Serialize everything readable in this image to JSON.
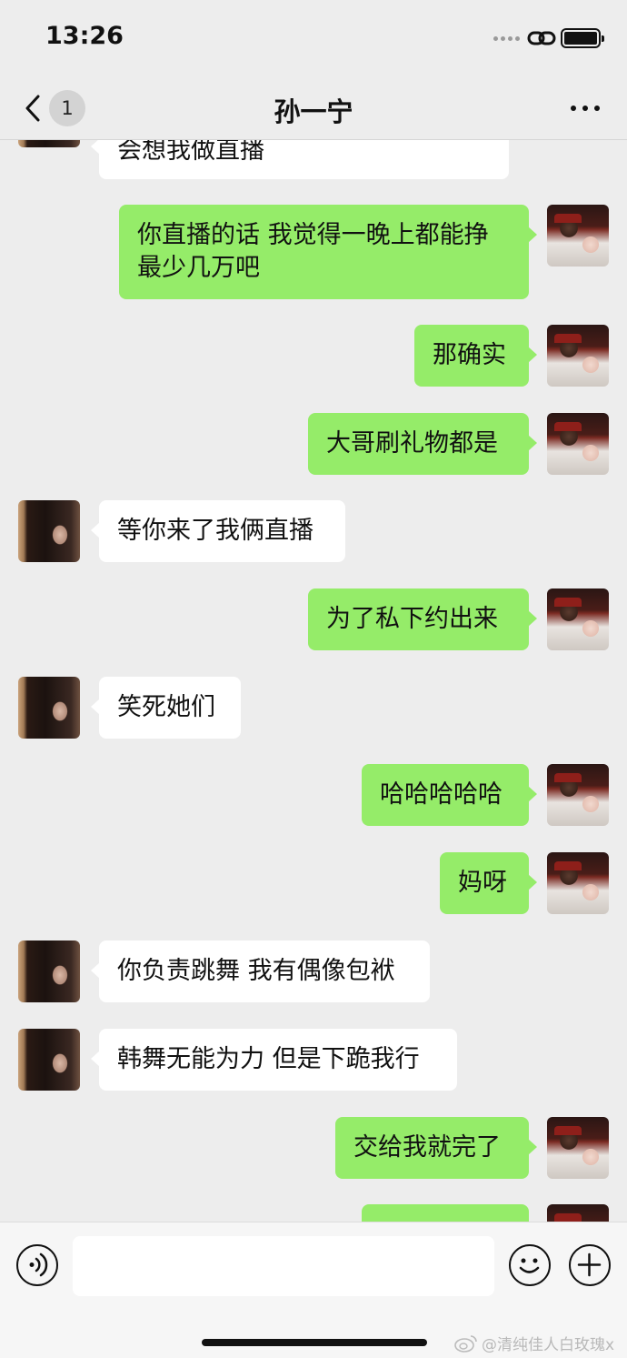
{
  "status_bar": {
    "time": "13:26"
  },
  "nav": {
    "unread_count": "1",
    "title": "孙一宁"
  },
  "messages": [
    {
      "side": "in",
      "text": "会想我做直播"
    },
    {
      "side": "out",
      "text": "你直播的话 我觉得一晚上都能挣\n最少几万吧"
    },
    {
      "side": "out",
      "text": "那确实"
    },
    {
      "side": "out",
      "text": "大哥刷礼物都是"
    },
    {
      "side": "in",
      "text": "等你来了我俩直播"
    },
    {
      "side": "out",
      "text": "为了私下约出来"
    },
    {
      "side": "in",
      "text": "笑死她们"
    },
    {
      "side": "out",
      "text": "哈哈哈哈哈"
    },
    {
      "side": "out",
      "text": "妈呀"
    },
    {
      "side": "in",
      "text": "你负责跳舞 我有偶像包袱"
    },
    {
      "side": "in",
      "text": "韩舞无能为力 但是下跪我行"
    },
    {
      "side": "out",
      "text": "交给我就完了"
    },
    {
      "side": "out",
      "text": ""
    }
  ],
  "input": {
    "value": ""
  },
  "watermark": {
    "text": "@清纯佳人白玫瑰x"
  },
  "colors": {
    "outgoing_bubble": "#95ec69",
    "incoming_bubble": "#ffffff",
    "background": "#ededed"
  }
}
